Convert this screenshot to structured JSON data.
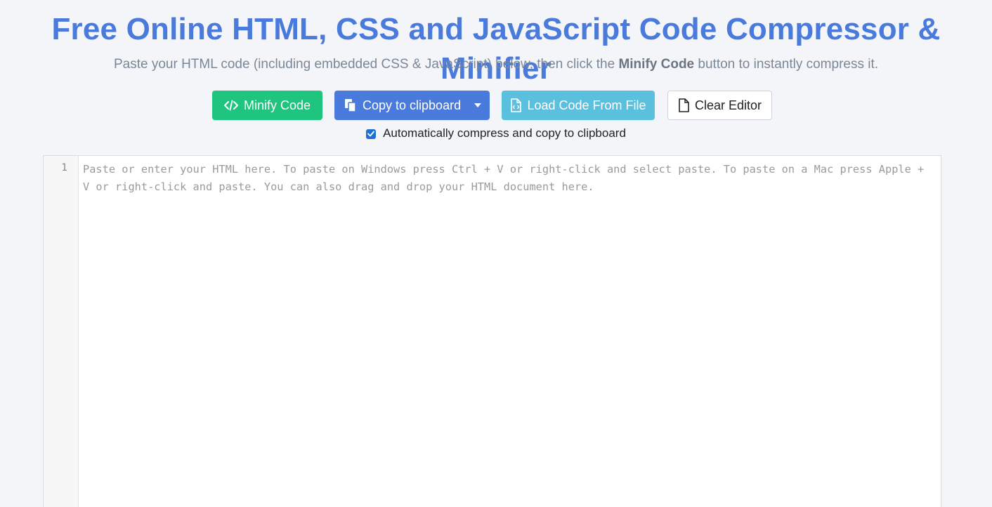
{
  "header": {
    "title": "Free Online HTML, CSS and JavaScript Code Compressor & Minifier",
    "subtitle_before": "Paste your HTML code (including embedded CSS & JavaScript) below, then click the ",
    "subtitle_bold": "Minify Code",
    "subtitle_after": " button to instantly compress it."
  },
  "toolbar": {
    "minify_label": "Minify Code",
    "copy_label": "Copy to clipboard",
    "load_label": "Load Code From File",
    "clear_label": "Clear Editor",
    "icons": {
      "minify": "code-icon",
      "copy": "copy-icon",
      "load": "file-code-icon",
      "clear": "file-icon",
      "dropdown": "caret-down-icon"
    }
  },
  "options": {
    "auto_label": "Automatically compress and copy to clipboard",
    "auto_checked": true
  },
  "editor": {
    "line_number": "1",
    "placeholder": "Paste or enter your HTML here. To paste on Windows press Ctrl + V or right-click and select paste. To paste on a Mac press Apple + V or right-click and paste. You can also drag and drop your HTML document here."
  },
  "colors": {
    "title": "#4a7bdc",
    "minify_button": "#1fc57f",
    "copy_button": "#4a7bdc",
    "load_button": "#5bc0de",
    "checkbox": "#1e6fd9",
    "background": "#f4f5f9"
  }
}
